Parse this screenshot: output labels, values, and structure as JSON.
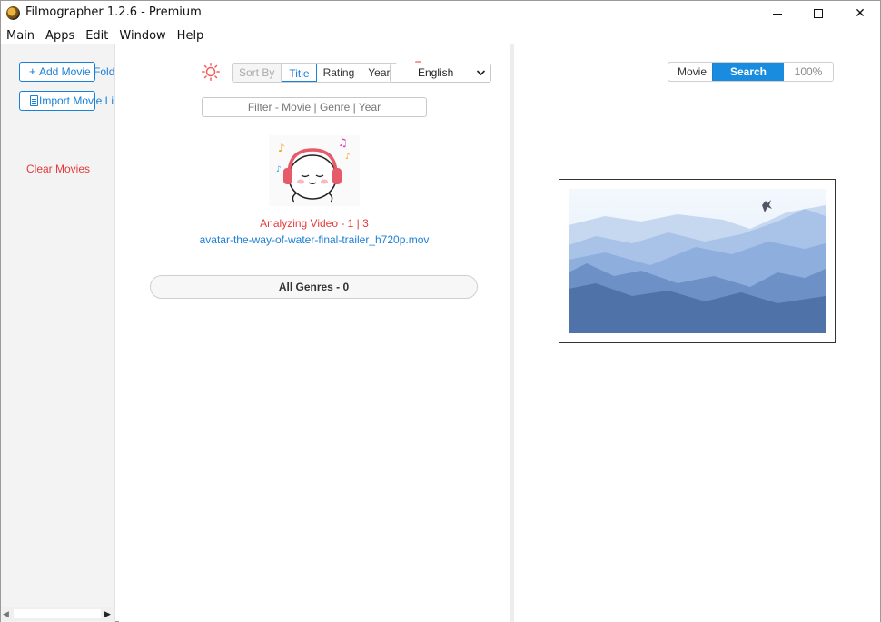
{
  "window": {
    "title": "Filmographer 1.2.6 - Premium",
    "minimize_glyph": "",
    "maximize_glyph": "",
    "close_glyph": "✕"
  },
  "menu": [
    "Main",
    "Apps",
    "Edit",
    "Window",
    "Help"
  ],
  "sidebar": {
    "add_movie_label": "Add Movie Folder",
    "add_movie_icon": "plus-icon",
    "import_list_label": "Import Movie List",
    "import_list_icon": "document-icon",
    "clear_movies_label": "Clear Movies"
  },
  "toolbar": {
    "theme_icon": "sun-icon",
    "sort_by_label": "Sort By",
    "sort_options": [
      "Title",
      "Rating",
      "Year"
    ],
    "sort_selected": "Title",
    "language_selected": "English",
    "filter_placeholder": "Filter - Movie | Genre | Year"
  },
  "main": {
    "status": "Analyzing Video - 1 | 3",
    "file_name": "avatar-the-way-of-water-final-trailer_h720p.mov",
    "genres_label": "All Genres - 0"
  },
  "right_panel": {
    "tabs": [
      "Movie",
      "Search",
      "100%"
    ],
    "active_tab": "Search"
  },
  "colors": {
    "accent": "#1a8ce0",
    "danger": "#e33b3b",
    "link": "#1a7fd6"
  }
}
